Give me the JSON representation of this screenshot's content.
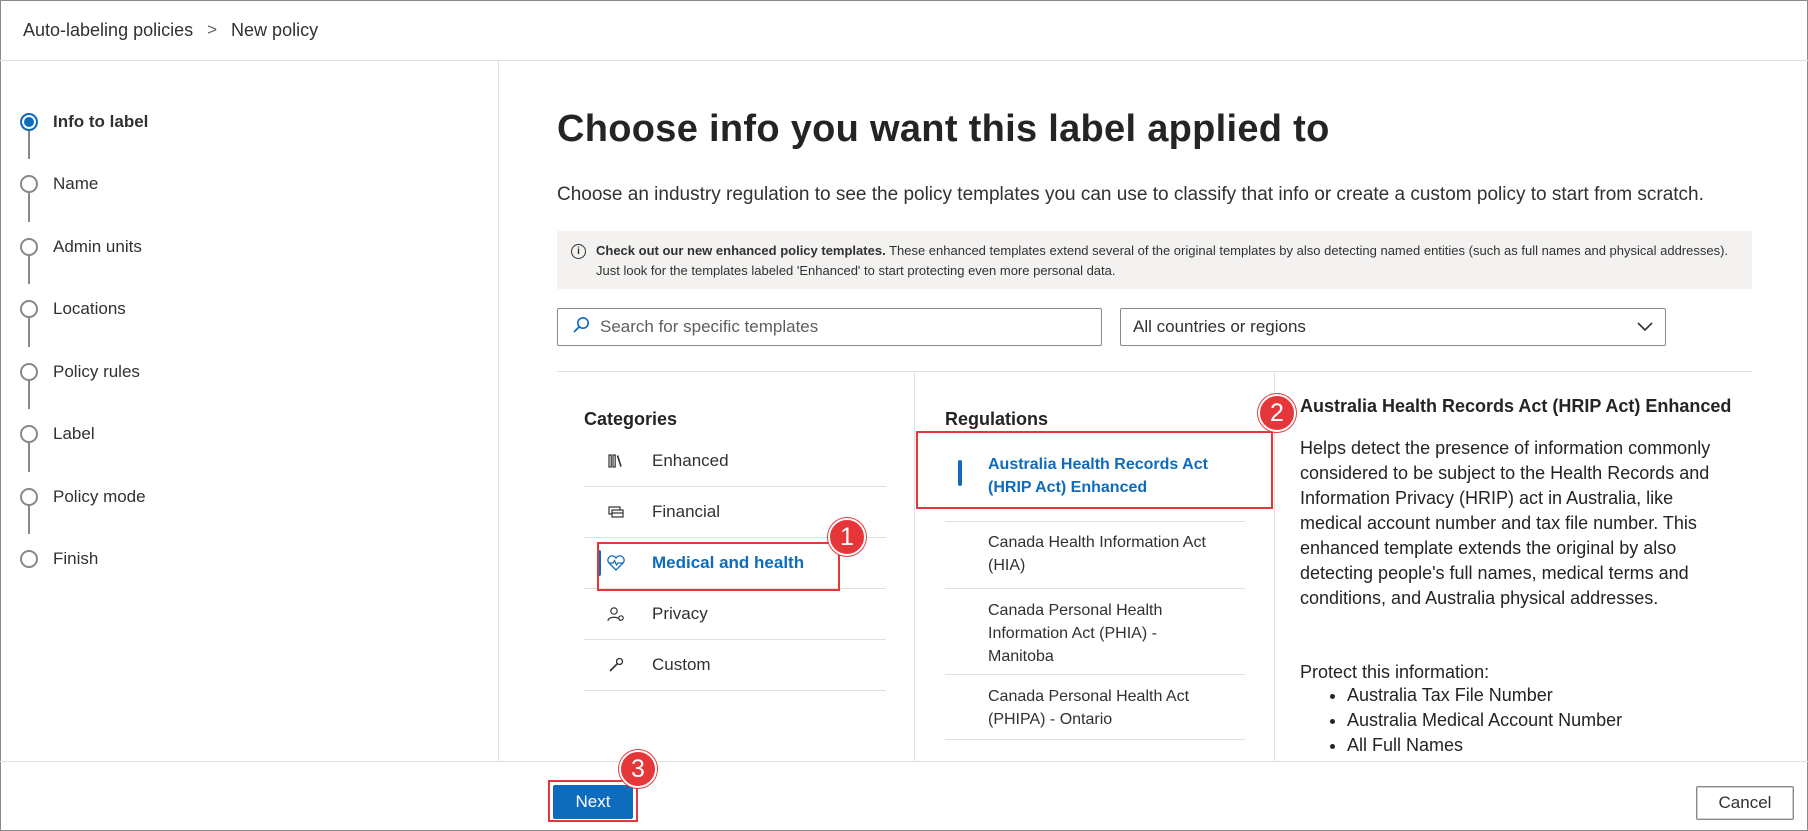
{
  "breadcrumb": {
    "parent": "Auto-labeling policies",
    "separator": ">",
    "current": "New policy"
  },
  "steps": [
    {
      "label": "Info to label",
      "active": true
    },
    {
      "label": "Name",
      "active": false
    },
    {
      "label": "Admin units",
      "active": false
    },
    {
      "label": "Locations",
      "active": false
    },
    {
      "label": "Policy rules",
      "active": false
    },
    {
      "label": "Label",
      "active": false
    },
    {
      "label": "Policy mode",
      "active": false
    },
    {
      "label": "Finish",
      "active": false
    }
  ],
  "main": {
    "title": "Choose info you want this label applied to",
    "description": "Choose an industry regulation to see the policy templates you can use to classify that info or create a custom policy to start from scratch.",
    "info_bold": "Check out our new enhanced policy templates.",
    "info_text": " These enhanced templates extend several of the original templates by also detecting named entities (such as full names and physical addresses). Just look for the templates labeled 'Enhanced' to start protecting even more personal data.",
    "search_placeholder": "Search for specific templates",
    "region_selected": "All countries or regions"
  },
  "categories": {
    "header": "Categories",
    "items": [
      {
        "label": "Enhanced",
        "icon": "books-icon",
        "active": false
      },
      {
        "label": "Financial",
        "icon": "card-icon",
        "active": false
      },
      {
        "label": "Medical and health",
        "icon": "heart-pulse-icon",
        "active": true
      },
      {
        "label": "Privacy",
        "icon": "person-privacy-icon",
        "active": false
      },
      {
        "label": "Custom",
        "icon": "wrench-icon",
        "active": false
      }
    ]
  },
  "regulations": {
    "header": "Regulations",
    "items": [
      {
        "line1": "Australia Health Records Act",
        "line2": "(HRIP Act) Enhanced",
        "line3": "",
        "active": true
      },
      {
        "line1": "Canada Health Information Act",
        "line2": "(HIA)",
        "line3": "",
        "active": false
      },
      {
        "line1": "Canada Personal Health",
        "line2": "Information Act (PHIA) -",
        "line3": "Manitoba",
        "active": false
      },
      {
        "line1": "Canada Personal Health Act",
        "line2": "(PHIPA) - Ontario",
        "line3": "",
        "active": false
      }
    ]
  },
  "detail": {
    "title": "Australia Health Records Act (HRIP Act) Enhanced",
    "description": "Helps detect the presence of information commonly considered to be subject to the Health Records and Information Privacy (HRIP) act in Australia, like medical account number and tax file number. This enhanced template extends the original by also detecting people's full names, medical terms and conditions, and Australia physical addresses.",
    "protect_heading": "Protect this information:",
    "protect_items": [
      "Australia Tax File Number",
      "Australia Medical Account Number",
      "All Full Names"
    ]
  },
  "annotations": {
    "badge1": "1",
    "badge2": "2",
    "badge3": "3",
    "highlight_color": "#e5363a"
  },
  "footer": {
    "next_label": "Next",
    "cancel_label": "Cancel"
  },
  "colors": {
    "accent": "#0f6cbd",
    "border": "#8a8886",
    "divider": "#e1dfdd",
    "info_bg": "#f3f2f1"
  }
}
